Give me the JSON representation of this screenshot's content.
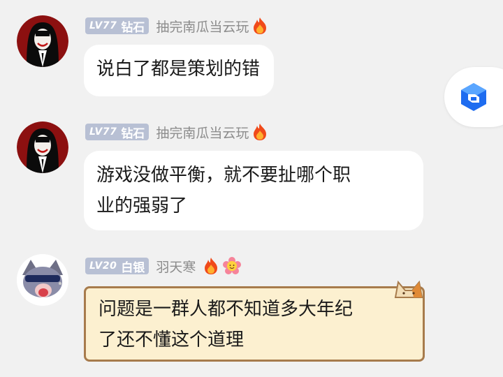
{
  "messages": [
    {
      "level": "LV77",
      "rank": "钻石",
      "username": "抽完南瓜当云玩",
      "text": "说白了都是策划的错"
    },
    {
      "level": "LV77",
      "rank": "钻石",
      "username": "抽完南瓜当云玩",
      "text_line1": "游戏没做平衡，就不要扯哪个职",
      "text_line2": "业的强弱了"
    },
    {
      "level": "LV20",
      "rank": "白银",
      "username": "羽天寒",
      "text_line1": "问题是一群人都不知道多大年纪",
      "text_line2": "了还不懂这个道理"
    }
  ],
  "colors": {
    "background": "#f1f1f1",
    "bubble": "#ffffff",
    "special_bubble": "#fcf0d0",
    "special_border": "#a77b4c",
    "badge": "#b8c0d4",
    "username": "#8c8c8c",
    "accent_blue": "#1e6cf0"
  },
  "icons": {
    "flame": "fire-icon",
    "side_button": "app-logo-icon",
    "badge_flower": "smiley-flower-icon",
    "bubble_cat": "cat-decoration-icon"
  }
}
